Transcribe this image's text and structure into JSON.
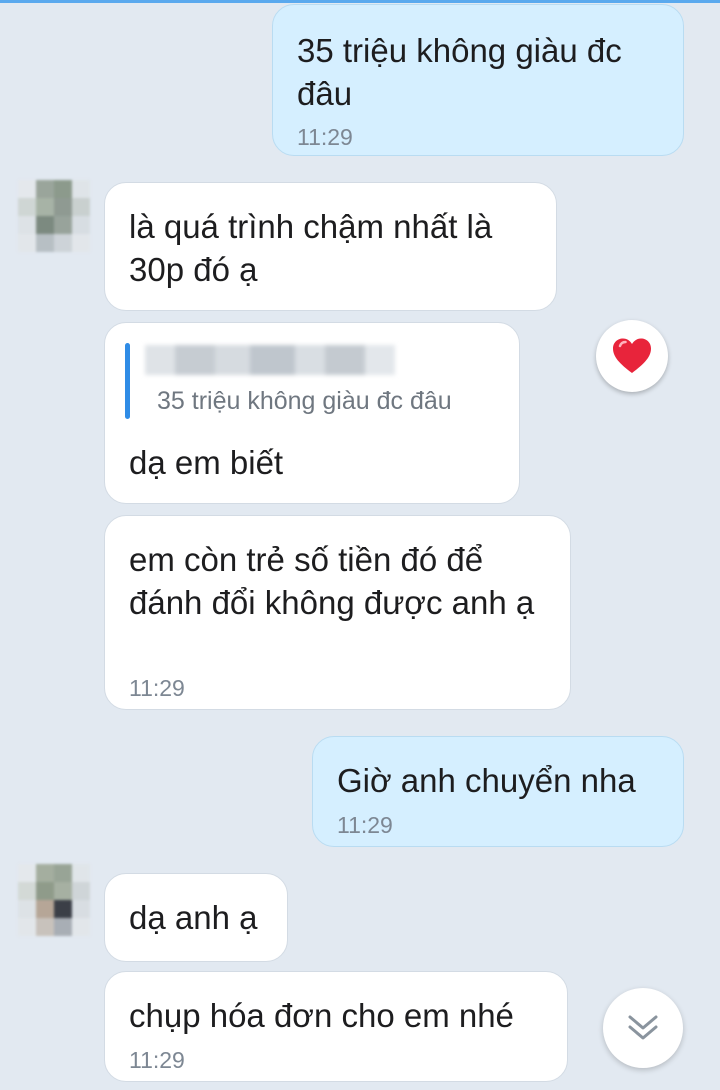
{
  "messages": {
    "m1": {
      "text": "35 triệu không giàu đc đâu",
      "time": "11:29"
    },
    "m2": {
      "text": "là quá trình chậm nhất là 30p đó ạ"
    },
    "m3": {
      "quote": "35 triệu không giàu đc đâu",
      "text": "dạ em biết"
    },
    "m4": {
      "text": "em còn trẻ số tiền đó để đánh đổi không được anh ạ",
      "time": "11:29"
    },
    "m5": {
      "text": "Giờ anh chuyển nha",
      "time": "11:29"
    },
    "m6": {
      "text": "dạ anh ạ"
    },
    "m7": {
      "text": "chụp hóa đơn cho em nhé",
      "time": "11:29"
    }
  },
  "reaction": {
    "icon": "heart-icon",
    "color": "#e8243b"
  },
  "scroll_button": {
    "icon": "double-chevron-down-icon"
  },
  "colors": {
    "background": "#e2e9f1",
    "outgoing_bubble": "#d5efff",
    "incoming_bubble": "#ffffff",
    "accent": "#2f8ce6"
  }
}
